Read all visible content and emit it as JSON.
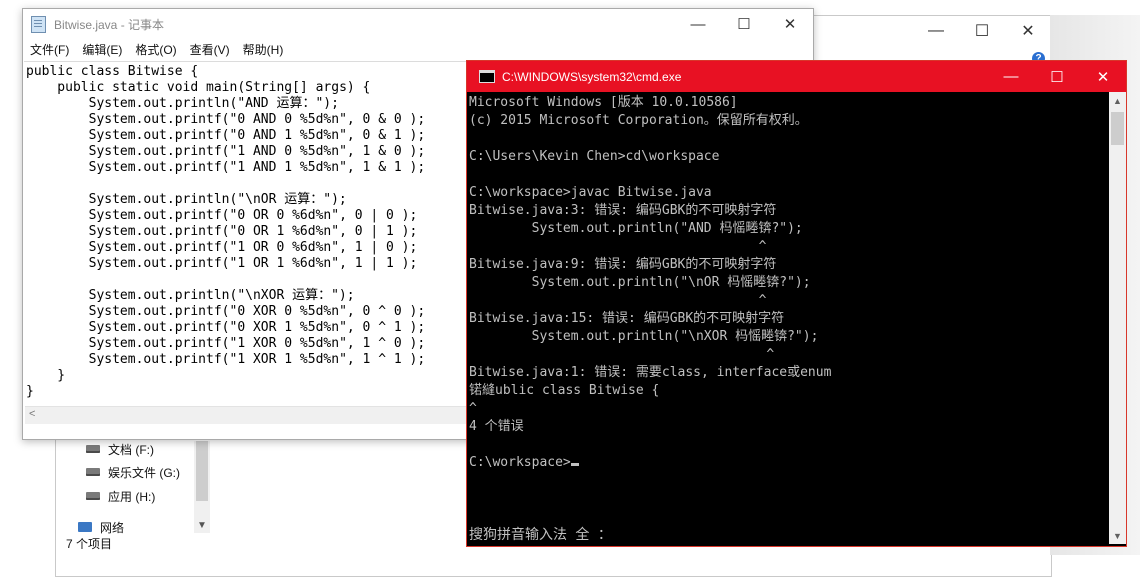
{
  "explorer": {
    "controls": {
      "minimize": "—",
      "maximize": "☐",
      "close": "✕"
    },
    "help_glyph": "?",
    "nav_items": [
      {
        "label": "文档 (F:)",
        "icon": "drive-icon"
      },
      {
        "label": "娱乐文件 (G:)",
        "icon": "drive-icon"
      },
      {
        "label": "应用 (H:)",
        "icon": "drive-icon"
      },
      {
        "label": "网络",
        "icon": "network-icon"
      }
    ],
    "status": "7 个项目"
  },
  "notepad": {
    "title": "Bitwise.java - 记事本",
    "controls": {
      "minimize": "—",
      "maximize": "☐",
      "close": "✕"
    },
    "menu": [
      "文件(F)",
      "编辑(E)",
      "格式(O)",
      "查看(V)",
      "帮助(H)"
    ],
    "content": "public class Bitwise {\n    public static void main(String[] args) {\n        System.out.println(\"AND 运算：\");\n        System.out.printf(\"0 AND 0 %5d%n\", 0 & 0 );\n        System.out.printf(\"0 AND 1 %5d%n\", 0 & 1 );\n        System.out.printf(\"1 AND 0 %5d%n\", 1 & 0 );\n        System.out.printf(\"1 AND 1 %5d%n\", 1 & 1 );\n\n        System.out.println(\"\\nOR 运算：\");\n        System.out.printf(\"0 OR 0 %6d%n\", 0 | 0 );\n        System.out.printf(\"0 OR 1 %6d%n\", 0 | 1 );\n        System.out.printf(\"1 OR 0 %6d%n\", 1 | 0 );\n        System.out.printf(\"1 OR 1 %6d%n\", 1 | 1 );\n\n        System.out.println(\"\\nXOR 运算：\");\n        System.out.printf(\"0 XOR 0 %5d%n\", 0 ^ 0 );\n        System.out.printf(\"0 XOR 1 %5d%n\", 0 ^ 1 );\n        System.out.printf(\"1 XOR 0 %5d%n\", 1 ^ 0 );\n        System.out.printf(\"1 XOR 1 %5d%n\", 1 ^ 1 );\n    }\n}"
  },
  "cmd": {
    "title": "C:\\WINDOWS\\system32\\cmd.exe",
    "controls": {
      "minimize": "—",
      "maximize": "☐",
      "close": "✕"
    },
    "output": "Microsoft Windows [版本 10.0.10586]\n(c) 2015 Microsoft Corporation。保留所有权利。\n\nC:\\Users\\Kevin Chen>cd\\workspace\n\nC:\\workspace>javac Bitwise.java\nBitwise.java:3: 错误: 编码GBK的不可映射字符\n        System.out.println(\"AND 杩愮畻锛?\");\n                                     ^\nBitwise.java:9: 错误: 编码GBK的不可映射字符\n        System.out.println(\"\\nOR 杩愮畻锛?\");\n                                     ^\nBitwise.java:15: 错误: 编码GBK的不可映射字符\n        System.out.println(\"\\nXOR 杩愮畻锛?\");\n                                      ^\nBitwise.java:1: 错误: 需要class, interface或enum\n锘縫ublic class Bitwise {\n^\n4 个错误\n\nC:\\workspace>",
    "ime_status": "搜狗拼音输入法 全 ："
  }
}
